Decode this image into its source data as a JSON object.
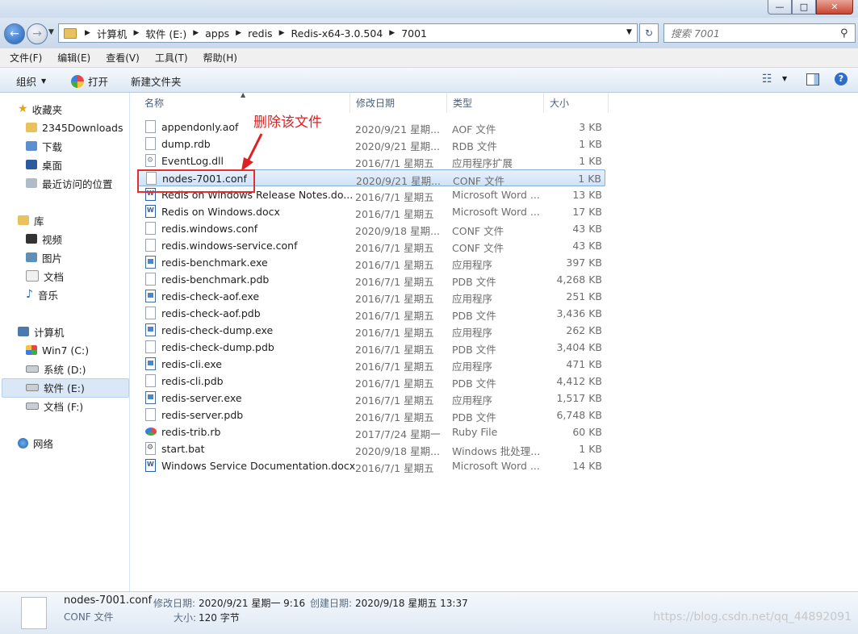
{
  "window": {
    "controls": [
      "—",
      "□",
      "✕"
    ]
  },
  "address": {
    "crumbs": [
      "计算机",
      "软件 (E:)",
      "apps",
      "redis",
      "Redis-x64-3.0.504",
      "7001"
    ]
  },
  "search": {
    "placeholder": "搜索 7001"
  },
  "menu": [
    "文件(F)",
    "编辑(E)",
    "查看(V)",
    "工具(T)",
    "帮助(H)"
  ],
  "toolbar": {
    "organize": "组织",
    "open": "打开",
    "new_folder": "新建文件夹"
  },
  "nav": {
    "favorites": "收藏夹",
    "fav_items": [
      "2345Downloads",
      "下载",
      "桌面",
      "最近访问的位置"
    ],
    "libraries": "库",
    "lib_items": [
      "视频",
      "图片",
      "文档",
      "音乐"
    ],
    "computer": "计算机",
    "drives": [
      "Win7 (C:)",
      "系统 (D:)",
      "软件 (E:)",
      "文档 (F:)"
    ],
    "network": "网络"
  },
  "columns": {
    "name": "名称",
    "date": "修改日期",
    "type": "类型",
    "size": "大小"
  },
  "files": [
    {
      "name": "appendonly.aof",
      "date": "2020/9/21 星期...",
      "type": "AOF 文件",
      "size": "3 KB",
      "icon": "file"
    },
    {
      "name": "dump.rdb",
      "date": "2020/9/21 星期...",
      "type": "RDB 文件",
      "size": "1 KB",
      "icon": "file"
    },
    {
      "name": "EventLog.dll",
      "date": "2016/7/1 星期五",
      "type": "应用程序扩展",
      "size": "1 KB",
      "icon": "dll"
    },
    {
      "name": "nodes-7001.conf",
      "date": "2020/9/21 星期...",
      "type": "CONF 文件",
      "size": "1 KB",
      "icon": "file"
    },
    {
      "name": "Redis on Windows Release Notes.do...",
      "date": "2016/7/1 星期五",
      "type": "Microsoft Word ...",
      "size": "13 KB",
      "icon": "docx"
    },
    {
      "name": "Redis on Windows.docx",
      "date": "2016/7/1 星期五",
      "type": "Microsoft Word ...",
      "size": "17 KB",
      "icon": "docx"
    },
    {
      "name": "redis.windows.conf",
      "date": "2020/9/18 星期...",
      "type": "CONF 文件",
      "size": "43 KB",
      "icon": "file"
    },
    {
      "name": "redis.windows-service.conf",
      "date": "2016/7/1 星期五",
      "type": "CONF 文件",
      "size": "43 KB",
      "icon": "file"
    },
    {
      "name": "redis-benchmark.exe",
      "date": "2016/7/1 星期五",
      "type": "应用程序",
      "size": "397 KB",
      "icon": "exe"
    },
    {
      "name": "redis-benchmark.pdb",
      "date": "2016/7/1 星期五",
      "type": "PDB 文件",
      "size": "4,268 KB",
      "icon": "file"
    },
    {
      "name": "redis-check-aof.exe",
      "date": "2016/7/1 星期五",
      "type": "应用程序",
      "size": "251 KB",
      "icon": "exe"
    },
    {
      "name": "redis-check-aof.pdb",
      "date": "2016/7/1 星期五",
      "type": "PDB 文件",
      "size": "3,436 KB",
      "icon": "file"
    },
    {
      "name": "redis-check-dump.exe",
      "date": "2016/7/1 星期五",
      "type": "应用程序",
      "size": "262 KB",
      "icon": "exe"
    },
    {
      "name": "redis-check-dump.pdb",
      "date": "2016/7/1 星期五",
      "type": "PDB 文件",
      "size": "3,404 KB",
      "icon": "file"
    },
    {
      "name": "redis-cli.exe",
      "date": "2016/7/1 星期五",
      "type": "应用程序",
      "size": "471 KB",
      "icon": "exe"
    },
    {
      "name": "redis-cli.pdb",
      "date": "2016/7/1 星期五",
      "type": "PDB 文件",
      "size": "4,412 KB",
      "icon": "file"
    },
    {
      "name": "redis-server.exe",
      "date": "2016/7/1 星期五",
      "type": "应用程序",
      "size": "1,517 KB",
      "icon": "exe"
    },
    {
      "name": "redis-server.pdb",
      "date": "2016/7/1 星期五",
      "type": "PDB 文件",
      "size": "6,748 KB",
      "icon": "file"
    },
    {
      "name": "redis-trib.rb",
      "date": "2017/7/24 星期一",
      "type": "Ruby File",
      "size": "60 KB",
      "icon": "rb"
    },
    {
      "name": "start.bat",
      "date": "2020/9/18 星期...",
      "type": "Windows 批处理...",
      "size": "1 KB",
      "icon": "bat"
    },
    {
      "name": "Windows Service Documentation.docx",
      "date": "2016/7/1 星期五",
      "type": "Microsoft Word ...",
      "size": "14 KB",
      "icon": "docx"
    }
  ],
  "annotation": "删除该文件",
  "details": {
    "name": "nodes-7001.conf",
    "type": "CONF 文件",
    "modified_label": "修改日期:",
    "modified": "2020/9/21 星期一 9:16",
    "created_label": "创建日期:",
    "created": "2020/9/18 星期五 13:37",
    "size_label": "大小:",
    "size": "120 字节"
  },
  "watermark": "https://blog.csdn.net/qq_44892091",
  "colors": {
    "annotation": "#e02020",
    "selection": "#cfe2f7"
  }
}
